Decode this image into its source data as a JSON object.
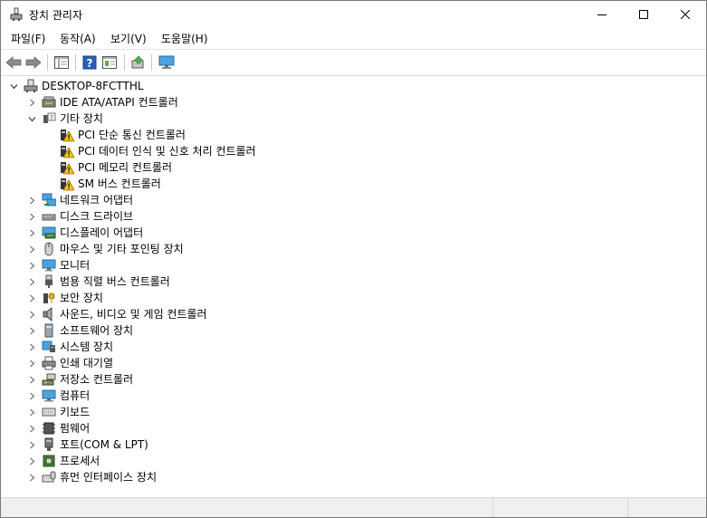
{
  "window": {
    "title": "장치 관리자"
  },
  "menu": [
    "파일(F)",
    "동작(A)",
    "보기(V)",
    "도움말(H)"
  ],
  "tree": [
    {
      "label": "DESKTOP-8FCTTHL",
      "level": 0,
      "expander": "open",
      "icon": "computer-root-icon"
    },
    {
      "label": "IDE ATA/ATAPI 컨트롤러",
      "level": 1,
      "expander": "closed",
      "icon": "ide-controller-icon"
    },
    {
      "label": "기타 장치",
      "level": 1,
      "expander": "open",
      "icon": "unknown-device-icon"
    },
    {
      "label": "PCI 단순 통신 컨트롤러",
      "level": 2,
      "expander": "none",
      "icon": "warning-device-icon"
    },
    {
      "label": "PCI 데이터 인식 및 신호 처리 컨트롤러",
      "level": 2,
      "expander": "none",
      "icon": "warning-device-icon"
    },
    {
      "label": "PCI 메모리 컨트롤러",
      "level": 2,
      "expander": "none",
      "icon": "warning-device-icon"
    },
    {
      "label": "SM 버스 컨트롤러",
      "level": 2,
      "expander": "none",
      "icon": "warning-device-icon"
    },
    {
      "label": "네트워크 어댑터",
      "level": 1,
      "expander": "closed",
      "icon": "network-adapter-icon"
    },
    {
      "label": "디스크 드라이브",
      "level": 1,
      "expander": "closed",
      "icon": "disk-drive-icon"
    },
    {
      "label": "디스플레이 어댑터",
      "level": 1,
      "expander": "closed",
      "icon": "display-adapter-icon"
    },
    {
      "label": "마우스 및 기타 포인팅 장치",
      "level": 1,
      "expander": "closed",
      "icon": "mouse-icon"
    },
    {
      "label": "모니터",
      "level": 1,
      "expander": "closed",
      "icon": "monitor-icon"
    },
    {
      "label": "범용 직렬 버스 컨트롤러",
      "level": 1,
      "expander": "closed",
      "icon": "usb-icon"
    },
    {
      "label": "보안 장치",
      "level": 1,
      "expander": "closed",
      "icon": "security-device-icon"
    },
    {
      "label": "사운드, 비디오 및 게임 컨트롤러",
      "level": 1,
      "expander": "closed",
      "icon": "speaker-icon"
    },
    {
      "label": "소프트웨어 장치",
      "level": 1,
      "expander": "closed",
      "icon": "software-device-icon"
    },
    {
      "label": "시스템 장치",
      "level": 1,
      "expander": "closed",
      "icon": "system-device-icon"
    },
    {
      "label": "인쇄 대기열",
      "level": 1,
      "expander": "closed",
      "icon": "printer-icon"
    },
    {
      "label": "저장소 컨트롤러",
      "level": 1,
      "expander": "closed",
      "icon": "storage-controller-icon"
    },
    {
      "label": "컴퓨터",
      "level": 1,
      "expander": "closed",
      "icon": "computer-icon"
    },
    {
      "label": "키보드",
      "level": 1,
      "expander": "closed",
      "icon": "keyboard-icon"
    },
    {
      "label": "펌웨어",
      "level": 1,
      "expander": "closed",
      "icon": "firmware-icon"
    },
    {
      "label": "포트(COM & LPT)",
      "level": 1,
      "expander": "closed",
      "icon": "port-icon"
    },
    {
      "label": "프로세서",
      "level": 1,
      "expander": "closed",
      "icon": "processor-icon"
    },
    {
      "label": "휴먼 인터페이스 장치",
      "level": 1,
      "expander": "closed",
      "icon": "hid-icon"
    }
  ]
}
